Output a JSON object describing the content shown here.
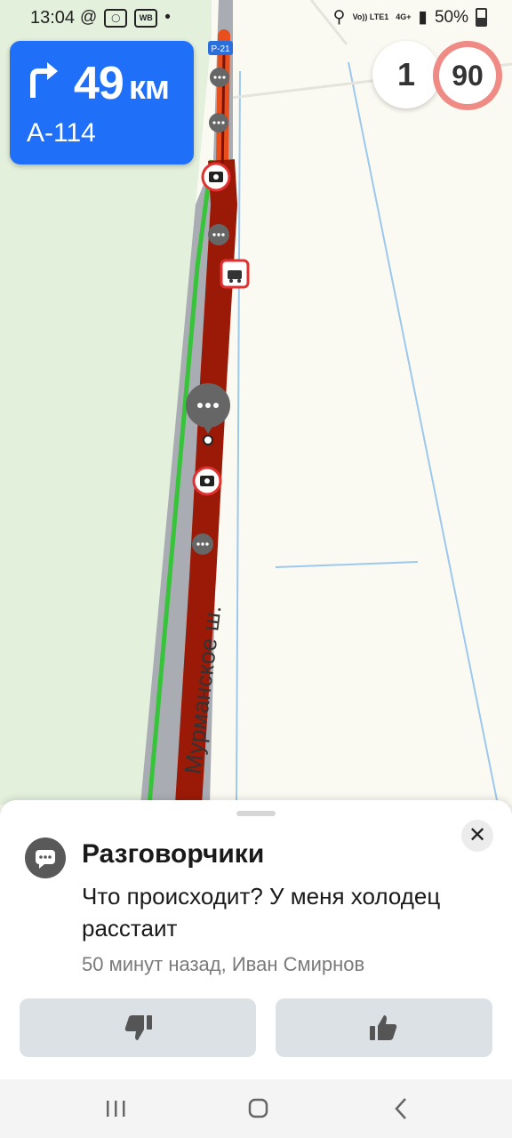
{
  "status_bar": {
    "time": "13:04",
    "left_icons": [
      "at-icon",
      "app-icon",
      "wb-icon",
      "dot-icon"
    ],
    "wb_label": "WB",
    "network_label": "Vo)) LTE1",
    "network_label2": "4G+",
    "battery": "50%"
  },
  "maneuver": {
    "distance": "49",
    "unit": "км",
    "road": "А-114"
  },
  "lanes": {
    "value": "1"
  },
  "speed_limit": {
    "value": "90"
  },
  "map": {
    "road_shield": "P-21",
    "street_name": "Мурманское ш."
  },
  "sheet": {
    "title": "Разговорчики",
    "message": "Что происходит? У меня холодец расстаит",
    "meta": "50 минут назад, Иван Смирнов",
    "close_icon": "close-icon",
    "dislike_icon": "thumbs-down-icon",
    "like_icon": "thumbs-up-icon"
  },
  "nav_bar": {
    "recents_icon": "recents-icon",
    "home_icon": "home-icon",
    "back_icon": "back-icon"
  },
  "colors": {
    "maneuver_bg": "#1f6ff8",
    "traffic_red": "#9b1a07",
    "traffic_orange": "#e84f1c",
    "speed_ring": "#f08a85",
    "greenbelt": "#e3f0dc"
  }
}
